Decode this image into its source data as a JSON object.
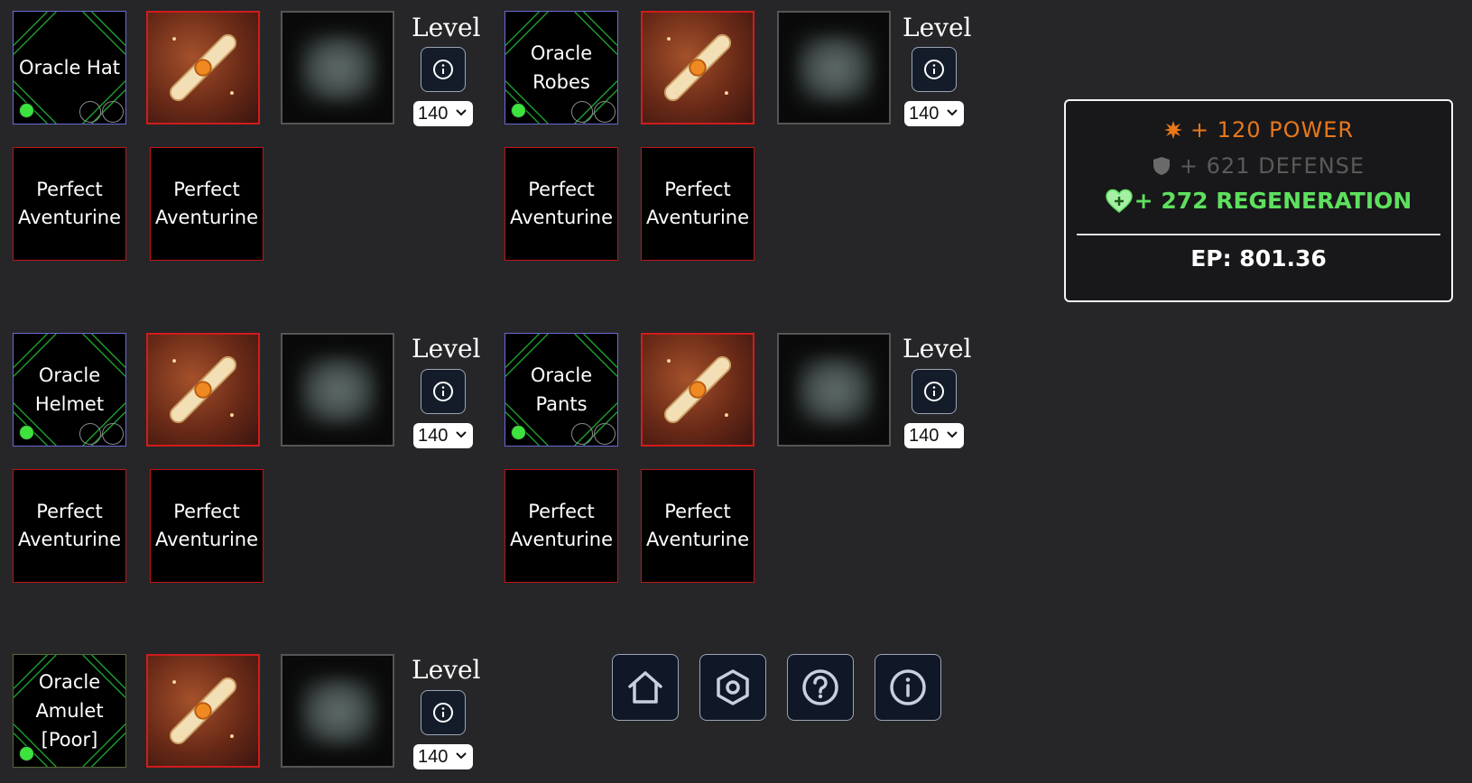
{
  "gear": {
    "hat": {
      "name": "Oracle Hat"
    },
    "robes": {
      "name": "Oracle Robes"
    },
    "helmet": {
      "name": "Oracle Helmet"
    },
    "pants": {
      "name": "Oracle Pants"
    },
    "amulet": {
      "name": "Oracle Amulet [Poor]"
    }
  },
  "gem_label": "Perfect Aventurine",
  "level_label": "Level",
  "level_value": "140",
  "stats": {
    "power": "+ 120 POWER",
    "defense": "+ 621 DEFENSE",
    "regeneration": "+ 272 REGENERATION",
    "ep": "EP: 801.36"
  },
  "colors": {
    "power": "#e8781a",
    "defense": "#5a5a5a",
    "regeneration": "#5ee05e",
    "gear_border": "#6a6ad8",
    "gem_border": "#c01414"
  },
  "icons": {
    "nav": [
      "home-icon",
      "settings-icon",
      "help-icon",
      "info-icon"
    ],
    "power": "star-burst-icon",
    "defense": "shield-icon",
    "regeneration": "heart-plus-icon"
  }
}
